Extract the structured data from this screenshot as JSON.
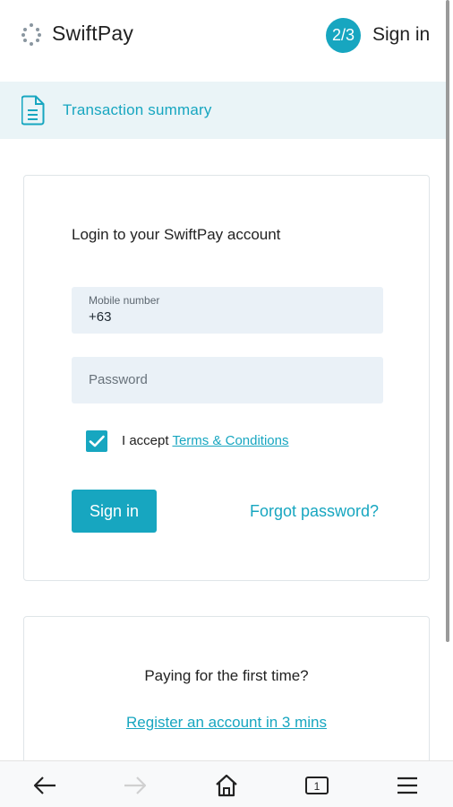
{
  "header": {
    "brand": "SwiftPay",
    "step": "2/3",
    "title": "Sign in"
  },
  "summary": {
    "label": "Transaction summary"
  },
  "login": {
    "heading": "Login to your SwiftPay account",
    "mobile": {
      "label": "Mobile number",
      "value": "+63"
    },
    "password": {
      "placeholder": "Password"
    },
    "terms": {
      "checked": true,
      "prefix": "I accept",
      "link": "Terms & Conditions"
    },
    "signin_button": "Sign in",
    "forgot_link": "Forgot password?"
  },
  "register": {
    "question": "Paying for the first time?",
    "link": "Register an account in 3 mins"
  },
  "browser_nav": {
    "tab_count": "1",
    "icons": [
      "back-arrow-icon",
      "forward-arrow-icon",
      "home-icon",
      "tabs-icon",
      "menu-icon"
    ]
  },
  "colors": {
    "accent": "#17a6c0",
    "summary_bg": "#eaf4f7",
    "field_bg": "#eaf1f7"
  }
}
